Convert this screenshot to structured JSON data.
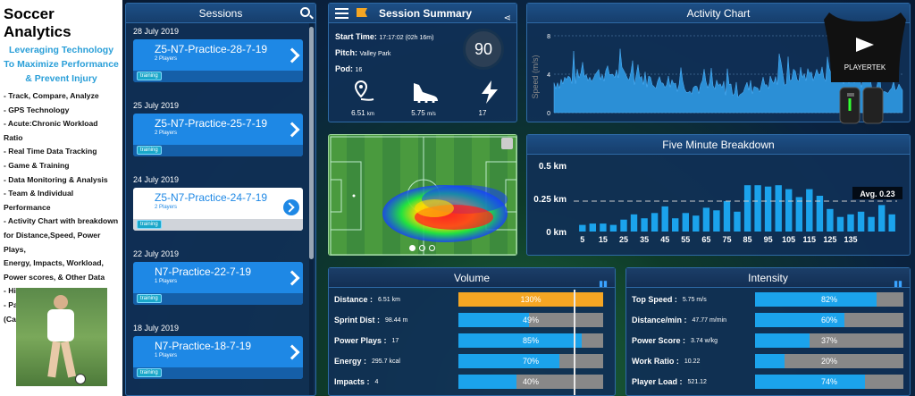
{
  "left": {
    "title": "Soccer Analytics",
    "subtitle": "Leveraging Technology To Maximize Performance & Prevent Injury",
    "bullets": [
      "- Track, Compare, Analyze",
      "- GPS Technology",
      "- Acute:Chronic Workload Ratio",
      "- Real Time Data Tracking",
      "- Game & Training",
      "- Data Monitoring & Analysis",
      "- Team & Individual Performance",
      "- Activity Chart with breakdown",
      "for Distance,Speed, Power Plays,",
      "Energy, Impacts, Workload,",
      "Power scores, & Other Data",
      "- Historical Data",
      "- Parnership w/ Playertek",
      "(Catapult)"
    ]
  },
  "sessions": {
    "title": "Sessions",
    "groups": [
      {
        "date": "28 July 2019",
        "name": "Z5-N7-Practice-28-7-19",
        "players": "2 Players",
        "tag": "training"
      },
      {
        "date": "25 July 2019",
        "name": "Z5-N7-Practice-25-7-19",
        "players": "2 Players",
        "tag": "training"
      },
      {
        "date": "24 July 2019",
        "name": "Z5-N7-Practice-24-7-19",
        "players": "2 Players",
        "tag": "training"
      },
      {
        "date": "22 July 2019",
        "name": "N7-Practice-22-7-19",
        "players": "1 Players",
        "tag": "training"
      },
      {
        "date": "18 July 2019",
        "name": "N7-Practice-18-7-19",
        "players": "1 Players",
        "tag": "training"
      }
    ]
  },
  "summary": {
    "title": "Session Summary",
    "start_label": "Start Time:",
    "start_value": "17:17:02 (02h 16m)",
    "pitch_label": "Pitch:",
    "pitch_value": "Valley Park",
    "pod_label": "Pod:",
    "pod_value": "16",
    "score": "90",
    "distance": "6.51",
    "distance_unit": "km",
    "speed": "5.75",
    "speed_unit": "m/s",
    "power": "17"
  },
  "activity": {
    "title": "Activity Chart",
    "ylabel": "Speed (m/s)",
    "ticks": [
      "8",
      "4",
      "0"
    ]
  },
  "five": {
    "title": "Five Minute Breakdown",
    "avg_label": "Avg.",
    "avg_value": "0.23"
  },
  "device_brand": "PLAYERTEK",
  "volume": {
    "title": "Volume",
    "rows": [
      {
        "label": "Distance :",
        "value": "6.51 km",
        "pct": "130%",
        "fill": 1.0,
        "color": "#f5a623"
      },
      {
        "label": "Sprint Dist :",
        "value": "98.44 m",
        "pct": "49%",
        "fill": 0.49,
        "color": "#1ba3ec"
      },
      {
        "label": "Power Plays :",
        "value": "17",
        "pct": "85%",
        "fill": 0.85,
        "color": "#1ba3ec"
      },
      {
        "label": "Energy :",
        "value": "295.7 kcal",
        "pct": "70%",
        "fill": 0.7,
        "color": "#1ba3ec"
      },
      {
        "label": "Impacts :",
        "value": "4",
        "pct": "40%",
        "fill": 0.4,
        "color": "#1ba3ec"
      }
    ]
  },
  "intensity": {
    "title": "Intensity",
    "rows": [
      {
        "label": "Top Speed :",
        "value": "5.75 m/s",
        "pct": "82%",
        "fill": 0.82
      },
      {
        "label": "Distance/min :",
        "value": "47.77 m/min",
        "pct": "60%",
        "fill": 0.6
      },
      {
        "label": "Power Score :",
        "value": "3.74 w/kg",
        "pct": "37%",
        "fill": 0.37
      },
      {
        "label": "Work Ratio :",
        "value": "10.22",
        "pct": "20%",
        "fill": 0.2
      },
      {
        "label": "Player Load :",
        "value": "521.12",
        "pct": "74%",
        "fill": 0.74
      }
    ]
  },
  "chart_data": [
    {
      "type": "bar",
      "title": "Five Minute Breakdown",
      "xlabel": "",
      "ylabel": "",
      "categories": [
        5,
        10,
        15,
        20,
        25,
        30,
        35,
        40,
        45,
        50,
        55,
        60,
        65,
        70,
        75,
        80,
        85,
        90,
        95,
        100,
        105,
        110,
        115,
        120,
        125,
        130,
        135,
        140
      ],
      "values": [
        0.05,
        0.06,
        0.06,
        0.05,
        0.09,
        0.13,
        0.1,
        0.14,
        0.19,
        0.1,
        0.14,
        0.12,
        0.18,
        0.16,
        0.23,
        0.15,
        0.35,
        0.35,
        0.34,
        0.35,
        0.32,
        0.26,
        0.32,
        0.27,
        0.17,
        0.11,
        0.13,
        0.15,
        0.11,
        0.2,
        0.13
      ],
      "ylim": [
        0,
        0.5
      ],
      "ytick_labels": [
        "0.5 km",
        "0.25 km",
        "0 km"
      ],
      "xtick_labels": [
        "5",
        "15",
        "25",
        "35",
        "45",
        "55",
        "65",
        "75",
        "85",
        "95",
        "105",
        "115",
        "125",
        "135"
      ],
      "avg": 0.23
    },
    {
      "type": "area",
      "title": "Activity Chart",
      "ylabel": "Speed (m/s)",
      "ylim": [
        0,
        8
      ]
    }
  ]
}
